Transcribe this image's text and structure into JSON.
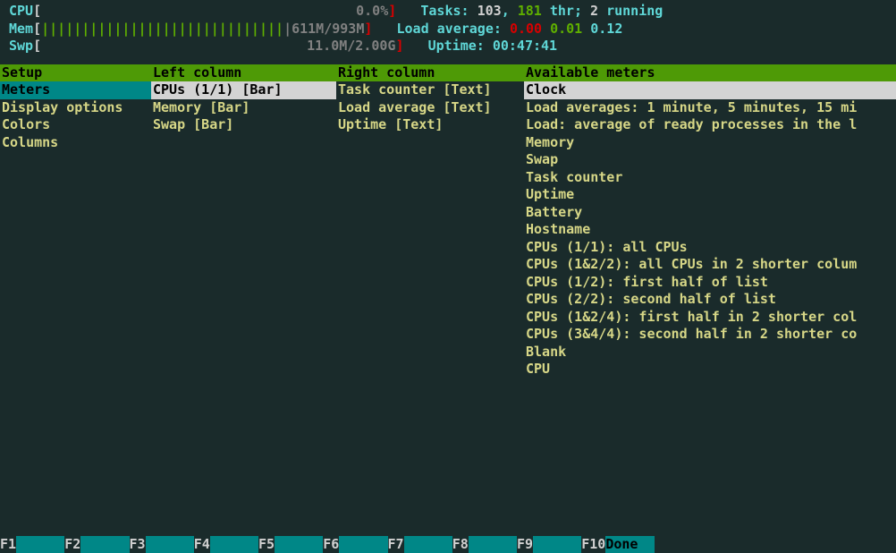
{
  "header": {
    "cpu": {
      "label": "CPU",
      "value": "0.0%"
    },
    "mem": {
      "label": "Mem",
      "value": "611M/993M",
      "bar": "||||||||||||||||||||||||||||||"
    },
    "swp": {
      "label": "Swp",
      "value": "11.0M/2.00G"
    },
    "tasks": {
      "label": "Tasks:",
      "procs": "103",
      "sep1": ",",
      "threads": "181",
      "thr": "thr;",
      "running": "2",
      "running_label": "running"
    },
    "load": {
      "label": "Load average:",
      "v1": "0.00",
      "v2": "0.01",
      "v3": "0.12"
    },
    "uptime": {
      "label": "Uptime:",
      "value": "00:47:41"
    }
  },
  "setup": {
    "title": "Setup",
    "items": [
      {
        "label": "Meters",
        "selected": true
      },
      {
        "label": "Display options"
      },
      {
        "label": "Colors"
      },
      {
        "label": "Columns"
      }
    ]
  },
  "left_column": {
    "title": "Left column",
    "items": [
      {
        "label": "CPUs (1/1) [Bar]",
        "selected": true
      },
      {
        "label": "Memory [Bar]"
      },
      {
        "label": "Swap [Bar]"
      }
    ]
  },
  "right_column": {
    "title": "Right column",
    "items": [
      {
        "label": "Task counter [Text]"
      },
      {
        "label": "Load average [Text]"
      },
      {
        "label": "Uptime [Text]"
      }
    ]
  },
  "available": {
    "title": "Available meters",
    "items": [
      {
        "label": "Clock",
        "selected": true
      },
      {
        "label": "Load averages: 1 minute, 5 minutes, 15 mi"
      },
      {
        "label": "Load: average of ready processes in the l"
      },
      {
        "label": "Memory"
      },
      {
        "label": "Swap"
      },
      {
        "label": "Task counter"
      },
      {
        "label": "Uptime"
      },
      {
        "label": "Battery"
      },
      {
        "label": "Hostname"
      },
      {
        "label": "CPUs (1/1): all CPUs"
      },
      {
        "label": "CPUs (1&2/2): all CPUs in 2 shorter colum"
      },
      {
        "label": "CPUs (1/2): first half of list"
      },
      {
        "label": "CPUs (2/2): second half of list"
      },
      {
        "label": "CPUs (1&2/4): first half in 2 shorter col"
      },
      {
        "label": "CPUs (3&4/4): second half in 2 shorter co"
      },
      {
        "label": "Blank"
      },
      {
        "label": "CPU"
      }
    ]
  },
  "footer": {
    "keys": [
      {
        "key": "F1",
        "label": "      "
      },
      {
        "key": "F2",
        "label": "      "
      },
      {
        "key": "F3",
        "label": "      "
      },
      {
        "key": "F4",
        "label": "      "
      },
      {
        "key": "F5",
        "label": "      "
      },
      {
        "key": "F6",
        "label": "      "
      },
      {
        "key": "F7",
        "label": "      "
      },
      {
        "key": "F8",
        "label": "      "
      },
      {
        "key": "F9",
        "label": "      "
      },
      {
        "key": "F10",
        "label": "Done  "
      }
    ]
  }
}
